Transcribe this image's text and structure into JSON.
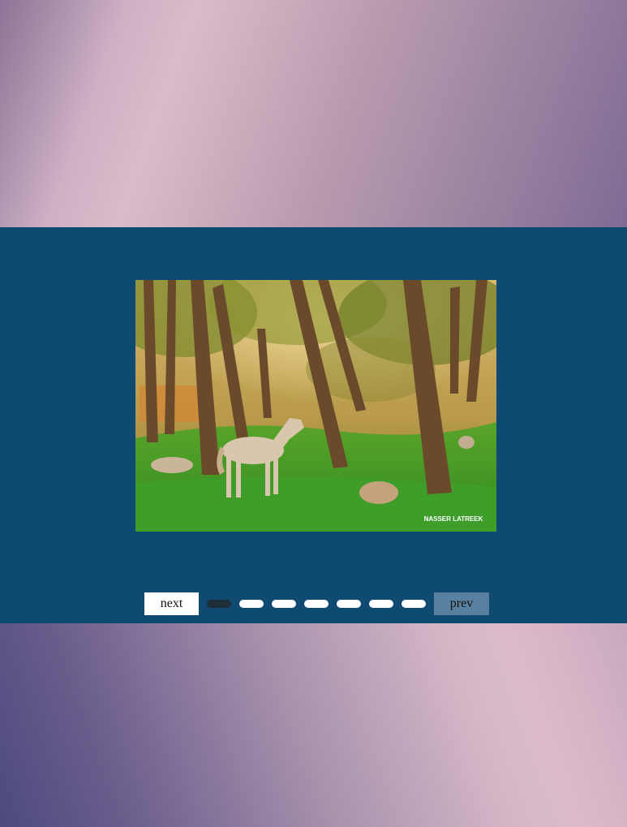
{
  "slider": {
    "next_label": "next",
    "prev_label": "prev",
    "slide_count": 7,
    "active_index": 0,
    "current_image": {
      "watermark": "NASSER LATREEK"
    }
  },
  "colors": {
    "band": "#0e4a72",
    "active_dot": "#1f2d38",
    "inactive_dot": "#ffffff",
    "prev_button": "#5a80a0",
    "next_button": "#ffffff"
  }
}
